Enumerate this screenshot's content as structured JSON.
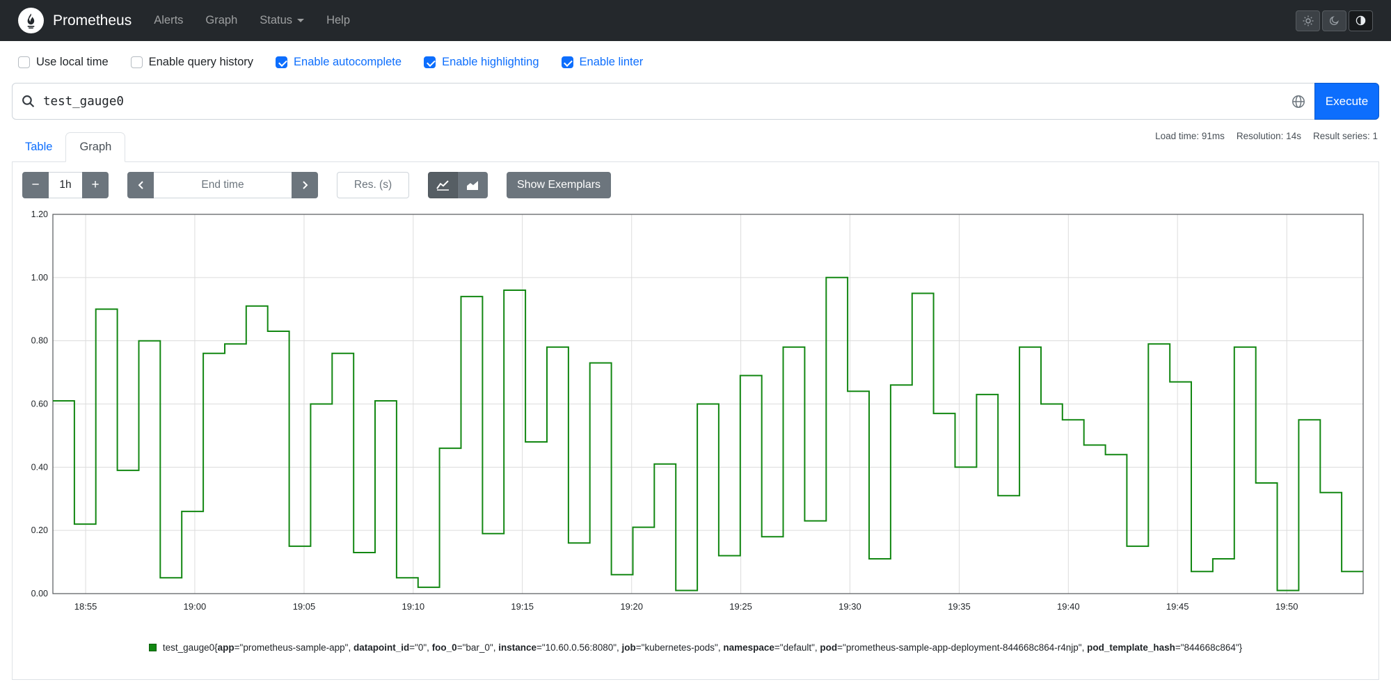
{
  "navbar": {
    "brand": "Prometheus",
    "links": [
      {
        "label": "Alerts"
      },
      {
        "label": "Graph"
      },
      {
        "label": "Status"
      },
      {
        "label": "Help"
      }
    ]
  },
  "options": {
    "items": [
      {
        "label": "Use local time",
        "checked": false
      },
      {
        "label": "Enable query history",
        "checked": false
      },
      {
        "label": "Enable autocomplete",
        "checked": true
      },
      {
        "label": "Enable highlighting",
        "checked": true
      },
      {
        "label": "Enable linter",
        "checked": true
      }
    ]
  },
  "query": {
    "value": "test_gauge0",
    "execute_label": "Execute"
  },
  "stats": {
    "load_time": "Load time: 91ms",
    "resolution": "Resolution: 14s",
    "result_series": "Result series: 1"
  },
  "tabs": [
    {
      "label": "Table",
      "active": false
    },
    {
      "label": "Graph",
      "active": true
    }
  ],
  "controls": {
    "minus_label": "−",
    "plus_label": "+",
    "range_value": "1h",
    "end_time_placeholder": "End time",
    "res_placeholder": "Res. (s)",
    "show_exemplars_label": "Show Exemplars"
  },
  "chart_data": {
    "type": "line",
    "step": true,
    "title": "",
    "xlabel": "",
    "ylabel": "",
    "grid": true,
    "ylim": [
      0,
      1.2
    ],
    "yticks": [
      "0.00",
      "0.20",
      "0.40",
      "0.60",
      "0.80",
      "1.00",
      "1.20"
    ],
    "xticks": [
      {
        "label": "18:55",
        "frac": 0.025
      },
      {
        "label": "19:00",
        "frac": 0.1083
      },
      {
        "label": "19:05",
        "frac": 0.1917
      },
      {
        "label": "19:10",
        "frac": 0.275
      },
      {
        "label": "19:15",
        "frac": 0.3583
      },
      {
        "label": "19:20",
        "frac": 0.4417
      },
      {
        "label": "19:25",
        "frac": 0.525
      },
      {
        "label": "19:30",
        "frac": 0.6083
      },
      {
        "label": "19:35",
        "frac": 0.6917
      },
      {
        "label": "19:40",
        "frac": 0.775
      },
      {
        "label": "19:45",
        "frac": 0.8583
      },
      {
        "label": "19:50",
        "frac": 0.9417
      }
    ],
    "series": [
      {
        "name": "test_gauge0",
        "color": "#128712",
        "values": [
          0.61,
          0.22,
          0.9,
          0.39,
          0.8,
          0.05,
          0.26,
          0.76,
          0.79,
          0.91,
          0.83,
          0.15,
          0.6,
          0.76,
          0.13,
          0.61,
          0.05,
          0.02,
          0.46,
          0.94,
          0.19,
          0.96,
          0.48,
          0.78,
          0.16,
          0.73,
          0.06,
          0.21,
          0.41,
          0.01,
          0.6,
          0.12,
          0.69,
          0.18,
          0.78,
          0.23,
          1.0,
          0.64,
          0.11,
          0.66,
          0.95,
          0.57,
          0.4,
          0.63,
          0.31,
          0.78,
          0.6,
          0.55,
          0.47,
          0.44,
          0.15,
          0.79,
          0.67,
          0.07,
          0.11,
          0.78,
          0.35,
          0.01,
          0.55,
          0.32,
          0.07
        ]
      }
    ]
  },
  "legend": {
    "metric": "test_gauge0",
    "labels": [
      {
        "name": "app",
        "value": "prometheus-sample-app"
      },
      {
        "name": "datapoint_id",
        "value": "0"
      },
      {
        "name": "foo_0",
        "value": "bar_0"
      },
      {
        "name": "instance",
        "value": "10.60.0.56:8080"
      },
      {
        "name": "job",
        "value": "kubernetes-pods"
      },
      {
        "name": "namespace",
        "value": "default"
      },
      {
        "name": "pod",
        "value": "prometheus-sample-app-deployment-844668c864-r4njp"
      },
      {
        "name": "pod_template_hash",
        "value": "844668c864"
      }
    ]
  }
}
